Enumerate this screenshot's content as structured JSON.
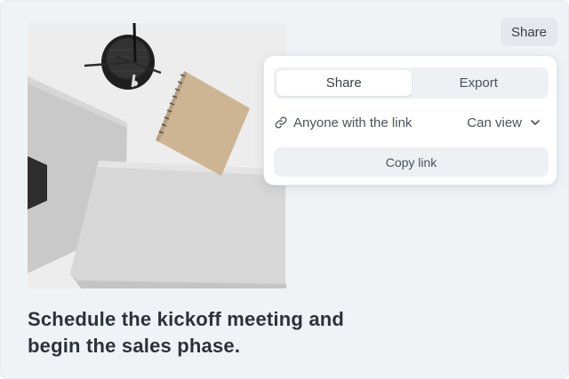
{
  "share_button": {
    "label": "Share"
  },
  "popover": {
    "tabs": [
      {
        "label": "Share",
        "active": true
      },
      {
        "label": "Export",
        "active": false
      }
    ],
    "access": {
      "icon": "link-icon",
      "label": "Anyone with the link",
      "permission": "Can view",
      "dropdown_icon": "chevron-down-icon"
    },
    "copy_button": {
      "label": "Copy link"
    }
  },
  "headline": "Schedule the kickoff meeting and begin the sales phase.",
  "colors": {
    "background": "#f0f3f6",
    "headline": "#2c3238",
    "button_bg": "#e4e7eb",
    "popover_bg": "#ffffff"
  }
}
